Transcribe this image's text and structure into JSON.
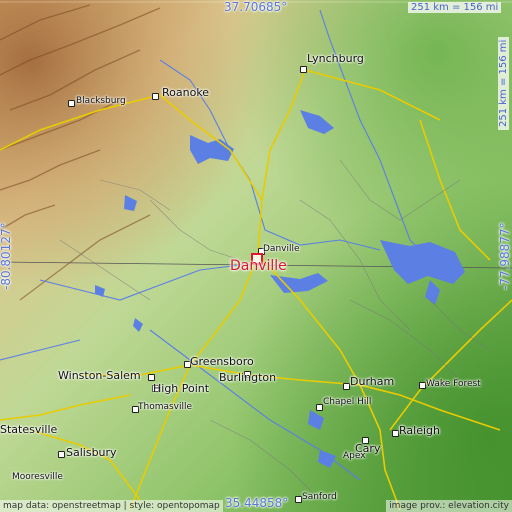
{
  "map": {
    "top_lat": "37.70685°",
    "bottom_lat": "35.44858°",
    "left_lon": "-80.80127°",
    "right_lon": "-77.98877°",
    "scale_top": "251 km = 156 mi",
    "scale_right": "251 km = 156 mi",
    "attribution_left": "map data: openstreetmap | style: opentopomap",
    "attribution_right": "image prov.: elevation.city"
  },
  "focus_city": {
    "name": "Danville",
    "color": "#d8192f"
  },
  "cities": {
    "lynchburg": "Lynchburg",
    "roanoke": "Roanoke",
    "blacksburg": "Blacksburg",
    "danville_small": "Danville",
    "greensboro": "Greensboro",
    "winston_salem": "Winston-Salem",
    "high_point": "High Point",
    "burlington": "Burlington",
    "thomasville": "Thomasville",
    "statesville": "Statesville",
    "salisbury": "Salisbury",
    "mooresville": "Mooresville",
    "durham": "Durham",
    "wake_forest": "Wake Forest",
    "chapel_hill": "Chapel Hill",
    "raleigh": "Raleigh",
    "cary": "Cary",
    "apex": "Apex",
    "sanford": "Sanford"
  },
  "colors": {
    "low": "#4f9a35",
    "mid": "#a8cf7e",
    "high": "#d6c28a",
    "mountain": "#b07c45",
    "water": "#5b7fe3",
    "road": "#f0d000"
  }
}
